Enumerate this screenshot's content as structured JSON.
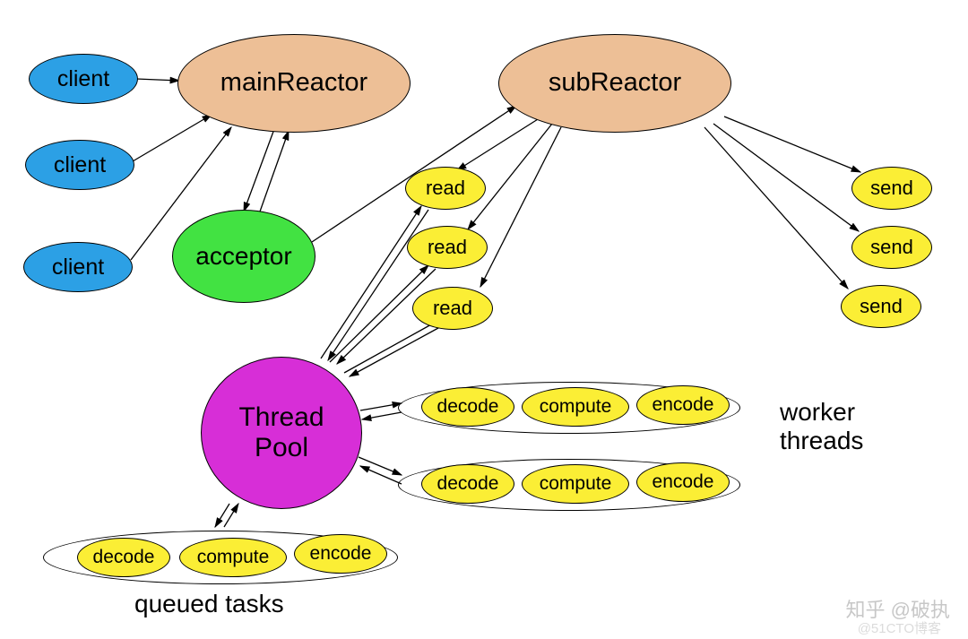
{
  "nodes": {
    "client1": "client",
    "client2": "client",
    "client3": "client",
    "mainReactor": "mainReactor",
    "subReactor": "subReactor",
    "acceptor": "acceptor",
    "read1": "read",
    "read2": "read",
    "read3": "read",
    "send1": "send",
    "send2": "send",
    "send3": "send",
    "threadPool": "Thread\nPool"
  },
  "pipelines": {
    "worker1": {
      "decode": "decode",
      "compute": "compute",
      "encode": "encode"
    },
    "worker2": {
      "decode": "decode",
      "compute": "compute",
      "encode": "encode"
    },
    "queued": {
      "decode": "decode",
      "compute": "compute",
      "encode": "encode"
    }
  },
  "labels": {
    "workerThreads": "worker\nthreads",
    "queuedTasks": "queued tasks"
  },
  "watermark": "知乎 @破执",
  "watermark2": "@51CTO博客"
}
